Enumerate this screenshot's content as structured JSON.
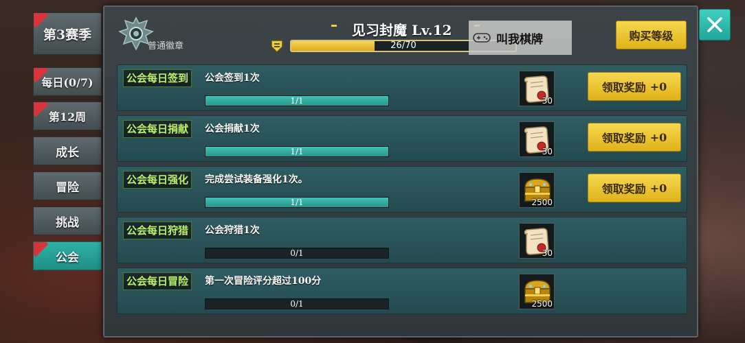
{
  "sidebar": {
    "tabs": [
      {
        "label": "第3赛季",
        "badge": true,
        "active": false
      },
      {
        "label": "每日(0/7)",
        "badge": true,
        "active": false
      },
      {
        "label": "第12周",
        "badge": true,
        "active": false
      },
      {
        "label": "成长",
        "badge": false,
        "active": false
      },
      {
        "label": "冒险",
        "badge": false,
        "active": false
      },
      {
        "label": "挑战",
        "badge": false,
        "active": false
      },
      {
        "label": "公会",
        "badge": true,
        "active": true
      }
    ]
  },
  "header": {
    "badge_label": "普通徽章",
    "level_title": "见习封魔 Lv.12",
    "xp": {
      "text": "26/70",
      "current": 26,
      "max": 70
    },
    "buy_button": "购买等级",
    "watermark": "叫我棋牌"
  },
  "tasks": [
    {
      "tag": "公会每日签到",
      "desc": "公会签到1次",
      "progress_text": "1/1",
      "progress": 1.0,
      "reward_icon": "scroll-icon",
      "reward_qty": "30",
      "claim_label": "领取奖励",
      "claim_count": "+0",
      "claimable": true
    },
    {
      "tag": "公会每日捐献",
      "desc": "公会捐献1次",
      "progress_text": "1/1",
      "progress": 1.0,
      "reward_icon": "scroll-icon",
      "reward_qty": "30",
      "claim_label": "领取奖励",
      "claim_count": "+0",
      "claimable": true
    },
    {
      "tag": "公会每日强化",
      "desc": "完成尝试装备强化1次。",
      "progress_text": "1/1",
      "progress": 1.0,
      "reward_icon": "treasure-chest-icon",
      "reward_qty": "2500",
      "claim_label": "领取奖励",
      "claim_count": "+0",
      "claimable": true
    },
    {
      "tag": "公会每日狩猎",
      "desc": "公会狩猎1次",
      "progress_text": "0/1",
      "progress": 0.0,
      "reward_icon": "scroll-icon",
      "reward_qty": "30",
      "claim_label": "",
      "claim_count": "",
      "claimable": false
    },
    {
      "tag": "公会每日冒险",
      "desc": "第一次冒险评分超过100分",
      "progress_text": "0/1",
      "progress": 0.0,
      "reward_icon": "treasure-chest-icon",
      "reward_qty": "2500",
      "claim_label": "",
      "claim_count": "",
      "claimable": false
    }
  ],
  "close_icon": "close-icon",
  "colors": {
    "accent": "#2fb1a6",
    "gold": "#f2c630",
    "tag_green": "#b9f06a",
    "badge_red": "#d8343b"
  }
}
